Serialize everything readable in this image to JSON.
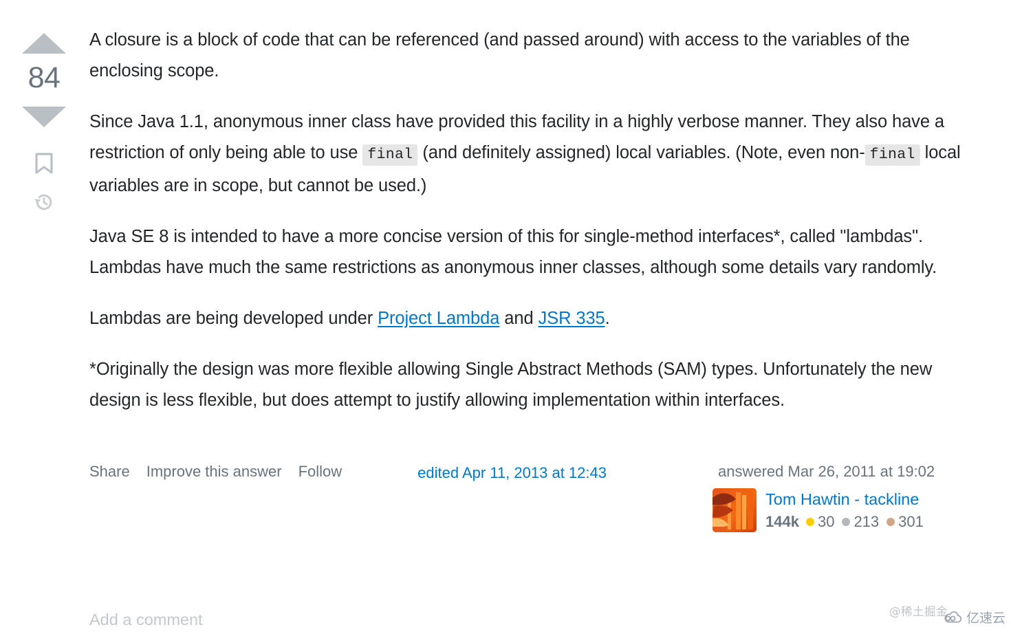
{
  "vote": {
    "up_icon": "vote-up-triangle-icon",
    "down_icon": "vote-down-triangle-icon",
    "score": "84",
    "bookmark_icon": "bookmark-icon",
    "history_icon": "history-clock-icon"
  },
  "post": {
    "paragraphs": [
      {
        "id": "p1",
        "parts": [
          {
            "type": "text",
            "value": "A closure is a block of code that can be referenced (and passed around) with access to the variables of the enclosing scope."
          }
        ]
      },
      {
        "id": "p2",
        "parts": [
          {
            "type": "text",
            "value": "Since Java 1.1, anonymous inner class have provided this facility in a highly verbose manner. They also have a restriction of only being able to use "
          },
          {
            "type": "code",
            "value": "final"
          },
          {
            "type": "text",
            "value": " (and definitely assigned) local variables. (Note, even non-"
          },
          {
            "type": "code",
            "value": "final"
          },
          {
            "type": "text",
            "value": " local variables are in scope, but cannot be used.)"
          }
        ]
      },
      {
        "id": "p3",
        "parts": [
          {
            "type": "text",
            "value": "Java SE 8 is intended to have a more concise version of this for single-method interfaces*, called \"lambdas\". Lambdas have much the same restrictions as anonymous inner classes, although some details vary randomly."
          }
        ]
      },
      {
        "id": "p4",
        "parts": [
          {
            "type": "text",
            "value": "Lambdas are being developed under "
          },
          {
            "type": "link",
            "value": "Project Lambda"
          },
          {
            "type": "text",
            "value": " and "
          },
          {
            "type": "link",
            "value": "JSR 335"
          },
          {
            "type": "text",
            "value": "."
          }
        ]
      },
      {
        "id": "p5",
        "parts": [
          {
            "type": "text",
            "value": "*Originally the design was more flexible allowing Single Abstract Methods (SAM) types. Unfortunately the new design is less flexible, but does attempt to justify allowing implementation within interfaces."
          }
        ]
      }
    ],
    "p1_text": "A closure is a block of code that can be referenced (and passed around) with access to the variables of the enclosing scope.",
    "p2_a": "Since Java 1.1, anonymous inner class have provided this facility in a highly verbose manner. They also have a restriction of only being able to use ",
    "p2_code1": "final",
    "p2_b": " (and definitely assigned) local variables. (Note, even non-",
    "p2_code2": "final",
    "p2_c": " local variables are in scope, but cannot be used.)",
    "p3_text": "Java SE 8 is intended to have a more concise version of this for single-method interfaces*, called \"lambdas\". Lambdas have much the same restrictions as anonymous inner classes, although some details vary randomly.",
    "p4_a": "Lambdas are being developed under ",
    "p4_link1": "Project Lambda",
    "p4_b": " and ",
    "p4_link2": "JSR 335",
    "p4_c": ".",
    "p5_text": "*Originally the design was more flexible allowing Single Abstract Methods (SAM) types. Unfortunately the new design is less flexible, but does attempt to justify allowing implementation within interfaces."
  },
  "footer": {
    "share_label": "Share",
    "improve_label": "Improve this answer",
    "follow_label": "Follow",
    "edited_text": "edited Apr 11, 2013 at 12:43",
    "answered_text": "answered Mar 26, 2011 at 19:02"
  },
  "user": {
    "avatar_name": "user-avatar-image",
    "display_name": "Tom Hawtin - tackline",
    "reputation": "144k",
    "badges": [
      {
        "type": "gold",
        "count": "30",
        "color": "#ffcc01"
      },
      {
        "type": "silver",
        "count": "213",
        "color": "#b4b8bc"
      },
      {
        "type": "bronze",
        "count": "301",
        "color": "#d1a684"
      }
    ]
  },
  "comments": {
    "add_comment_label": "Add a comment"
  },
  "watermarks": {
    "juejin": "@稀土掘金",
    "yisu": "亿速云",
    "yisu_icon": "cloud-logo-icon"
  },
  "colors": {
    "link": "#0077cc",
    "muted": "#6a737c",
    "body_text": "#232629",
    "vote_arrow": "#babfc4",
    "code_bg": "#e6e6e6"
  }
}
